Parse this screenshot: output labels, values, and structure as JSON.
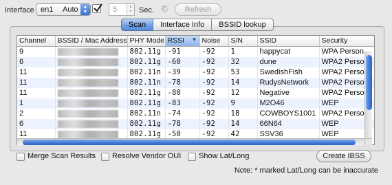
{
  "toolbar": {
    "interface_label": "Interface",
    "interface_value": "en1",
    "interface_mode": "Auto",
    "auto_checked": true,
    "seconds_value": "5",
    "seconds_label": "Sec.",
    "refresh_label": "Refresh"
  },
  "tabs": [
    {
      "label": "Scan",
      "active": true
    },
    {
      "label": "Interface Info",
      "active": false
    },
    {
      "label": "BSSID lookup",
      "active": false
    }
  ],
  "table": {
    "columns": [
      "Channel",
      "BSSID / Mac Address",
      "PHY Mode",
      "RSSI",
      "Noise",
      "S/N",
      "SSID",
      "Security"
    ],
    "sorted_column": "RSSI",
    "rows": [
      [
        "9",
        "",
        "802.11g",
        "-91",
        "-92",
        "1",
        "happycat",
        "WPA Person"
      ],
      [
        "6",
        "",
        "802.11g",
        "-60",
        "-92",
        "32",
        "dune",
        "WPA2 Perso"
      ],
      [
        "11",
        "",
        "802.11n",
        "-39",
        "-92",
        "53",
        "SwedishFish",
        "WPA2 Perso"
      ],
      [
        "11",
        "",
        "802.11n",
        "-78",
        "-92",
        "14",
        "RudysNetwork",
        "WPA2 Perso"
      ],
      [
        "11",
        "",
        "802.11g",
        "-80",
        "-92",
        "12",
        "Negative",
        "WPA2 Perso"
      ],
      [
        "1",
        "",
        "802.11g",
        "-83",
        "-92",
        "9",
        "M2O46",
        "WEP"
      ],
      [
        "2",
        "",
        "802.11n",
        "-74",
        "-92",
        "18",
        "COWBOYS1001",
        "WPA2 Perso"
      ],
      [
        "6",
        "",
        "802.11g",
        "-78",
        "-92",
        "14",
        "66N64",
        "WEP"
      ],
      [
        "11",
        "",
        "802.11g",
        "-50",
        "-92",
        "42",
        "SSV36",
        "WEP"
      ]
    ]
  },
  "options": {
    "merge_label": "Merge Scan Results",
    "vendor_label": "Resolve Vendor OUI",
    "latlong_label": "Show Lat/Long"
  },
  "create_ibss_label": "Create IBSS",
  "note": "Note: * marked Lat/Long can be inaccurate",
  "colors": {
    "accent": "#3d77d6",
    "row_alt": "#edf3fe"
  }
}
